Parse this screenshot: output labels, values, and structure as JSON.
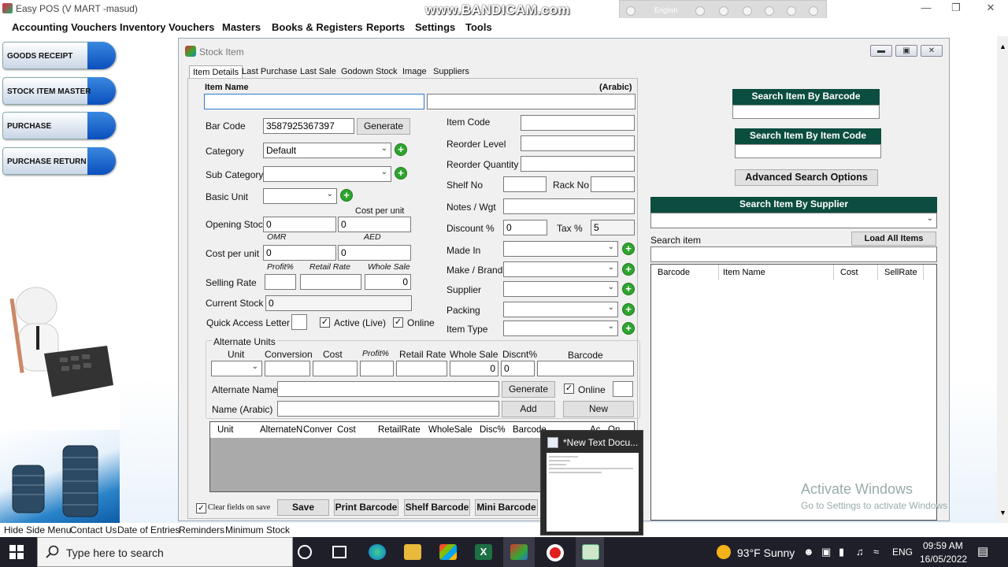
{
  "window": {
    "app_title": "Easy POS (V MART -masud)",
    "watermark": "www.BANDICAM.com",
    "bandicam_lang": "English"
  },
  "menu": [
    "Accounting Vouchers",
    "Inventory Vouchers",
    "Masters",
    "Books & Registers",
    "Reports",
    "Settings",
    "Tools"
  ],
  "sidebar": [
    "GOODS RECEIPT",
    "STOCK ITEM MASTER",
    "PURCHASE",
    "PURCHASE RETURN"
  ],
  "stock_window": {
    "title": "Stock Item",
    "tabs": [
      "Item Details",
      "Last Purchase",
      "Last Sale",
      "Godown Stock",
      "Image",
      "Suppliers"
    ],
    "item_name_label": "Item Name",
    "arabic_label": "(Arabic)",
    "bar_code_label": "Bar Code",
    "bar_code_value": "3587925367397",
    "generate_label": "Generate",
    "category_label": "Category",
    "category_value": "Default",
    "sub_category_label": "Sub Category",
    "basic_unit_label": "Basic Unit",
    "opening_stock_label": "Opening Stock",
    "opening_stock_value": "0",
    "cost_per_unit_top_label": "Cost per unit",
    "cost_per_unit_top_value": "0",
    "omr_label": "OMR",
    "aed_label": "AED",
    "cost_per_unit_label": "Cost per unit",
    "cost_omr_value": "0",
    "cost_aed_value": "0",
    "profit_label": "Profit%",
    "retail_rate_label": "Retail Rate",
    "whole_sale_label": "Whole Sale",
    "selling_rate_label": "Selling Rate",
    "whole_sale_value": "0",
    "current_stock_label": "Current Stock",
    "current_stock_value": "0",
    "quick_access_label": "Quick Access Letter",
    "active_label": "Active (Live)",
    "online_label": "Online",
    "item_code_label": "Item Code",
    "reorder_level_label": "Reorder Level",
    "reorder_qty_label": "Reorder Quantity",
    "shelf_no_label": "Shelf No",
    "rack_no_label": "Rack No",
    "notes_label": "Notes / Wgt",
    "discount_label": "Discount %",
    "discount_value": "0",
    "tax_label": "Tax %",
    "tax_value": "5",
    "made_in_label": "Made In",
    "make_brand_label": "Make / Brand",
    "supplier_label": "Supplier",
    "packing_label": "Packing",
    "item_type_label": "Item Type",
    "alt_units": {
      "title": "Alternate Units",
      "headers": [
        "Unit",
        "Conversion",
        "Cost",
        "Profit%",
        "Retail Rate",
        "Whole Sale",
        "Discnt%",
        "Barcode"
      ],
      "whole_sale_value": "0",
      "discnt_value": "0",
      "alt_name_label": "Alternate Name",
      "name_arabic_label": "Name (Arabic)",
      "generate_label": "Generate",
      "online_label": "Online",
      "add_label": "Add",
      "new_label": "New",
      "grid_headers": [
        "Unit",
        "AlternateN",
        "Conver",
        "Cost",
        "RetailRate",
        "WholeSale",
        "Disc%",
        "Barcode",
        "Ac",
        "On"
      ]
    },
    "clear_fields_label": "Clear fields on save",
    "save_label": "Save",
    "print_barcode_label": "Print Barcode",
    "shelf_barcode_label": "Shelf Barcode",
    "mini_barcode_label": "Mini Barcode",
    "search_by_barcode": "Search Item By Barcode",
    "search_by_code": "Search Item By Item Code",
    "advanced_search": "Advanced Search Options",
    "search_by_supplier": "Search Item By Supplier",
    "search_item_label": "Search item",
    "load_all_items": "Load All Items",
    "grid_headers": [
      "Barcode",
      "Item Name",
      "Cost",
      "SellRate"
    ]
  },
  "activate": {
    "line1": "Activate Windows",
    "line2": "Go to Settings to activate Windows"
  },
  "status_bar": [
    "Hide Side Menu",
    "Contact Us",
    "Date of Entries",
    "Reminders",
    "Minimum Stock"
  ],
  "thumbnail": {
    "title": "*New Text Docu..."
  },
  "taskbar": {
    "search_placeholder": "Type here to search",
    "weather": "93°F  Sunny",
    "lang": "ENG",
    "time": "09:59 AM",
    "date": "16/05/2022"
  },
  "colors": {
    "green_header": "#0b4d3f",
    "plus_green": "#2fa42f",
    "side_button_cap": "#0b4fbd"
  }
}
